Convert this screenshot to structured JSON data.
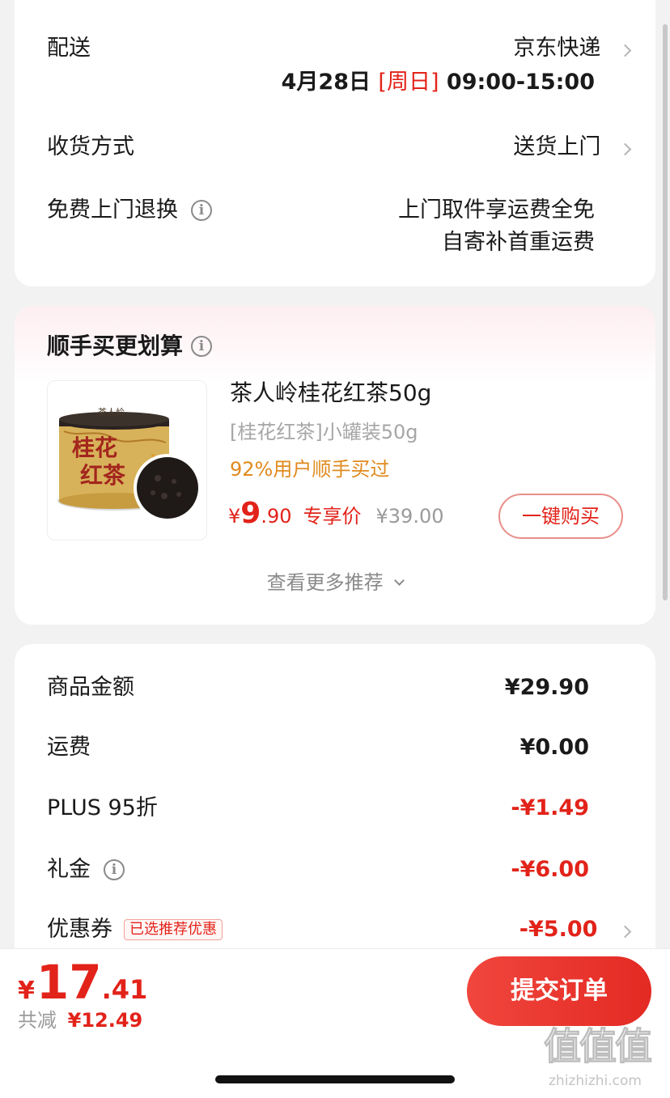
{
  "delivery": {
    "label": "配送",
    "carrier": "京东快递",
    "date": "4月28日",
    "weekday": "[周日]",
    "time": "09:00-15:00"
  },
  "receive": {
    "label": "收货方式",
    "value": "送货上门"
  },
  "free_return": {
    "label": "免费上门退换",
    "line1": "上门取件享运费全免",
    "line2": "自寄补首重运费"
  },
  "recommend": {
    "title": "顺手买更划算",
    "product": {
      "name": "茶人岭桂花红茶50g",
      "spec": "[桂花红茶]小罐装50g",
      "stat": "92%用户顺手买过",
      "price_symbol": "¥",
      "price_int": "9",
      "price_dec": ".90",
      "price_tag": "专享价",
      "orig_price": "¥39.00",
      "image_text_1": "桂花",
      "image_text_2": "红茶",
      "image_brand": "茶人岭"
    },
    "buy_button": "一键购买",
    "more": "查看更多推荐"
  },
  "summary": {
    "rows": [
      {
        "label": "商品金额",
        "value": "¥29.90"
      },
      {
        "label": "运费",
        "value": "¥0.00"
      },
      {
        "label": "PLUS 95折",
        "value": "-¥1.49"
      },
      {
        "label": "礼金",
        "value": "-¥6.00"
      },
      {
        "label": "优惠券",
        "value": "-¥5.00",
        "badge": "已选推荐优惠"
      }
    ]
  },
  "footer": {
    "symbol": "¥",
    "total_int": "17",
    "total_dec": ".41",
    "saved_label": "共减",
    "saved_value": "¥12.49",
    "submit": "提交订单"
  },
  "watermark": {
    "logo": "值值值",
    "site": "zhizhizhi.com"
  },
  "colors": {
    "accent": "#e2231a",
    "orange": "#e08a1d",
    "submit_gradient": [
      "#f0463d",
      "#e32a23"
    ]
  }
}
